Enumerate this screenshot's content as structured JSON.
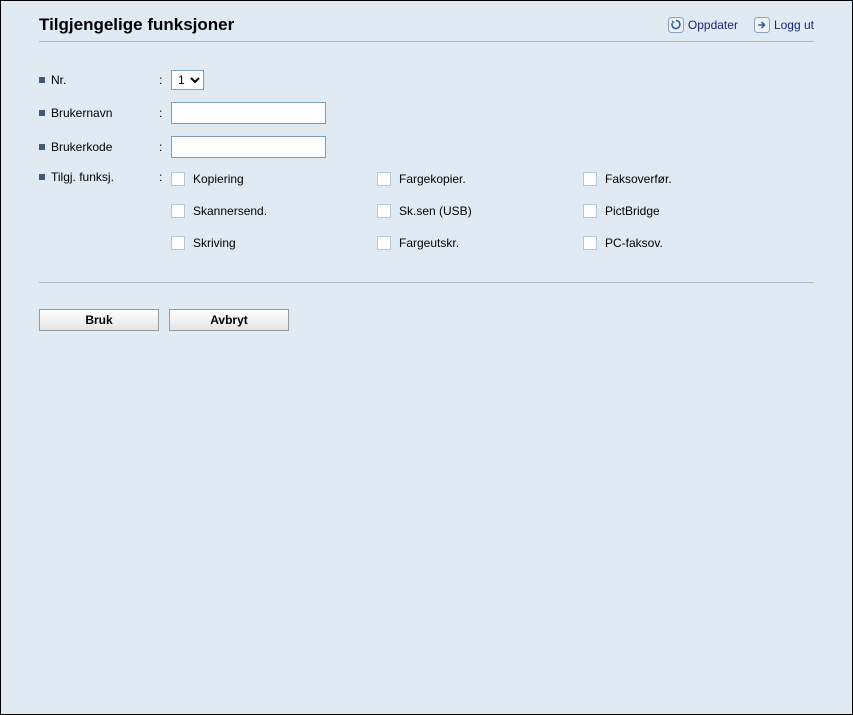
{
  "header": {
    "title": "Tilgjengelige funksjoner",
    "refresh_label": "Oppdater",
    "logout_label": "Logg ut"
  },
  "form": {
    "nr": {
      "label": "Nr.",
      "value": "1",
      "options": [
        "1"
      ]
    },
    "username": {
      "label": "Brukernavn",
      "value": ""
    },
    "usercode": {
      "label": "Brukerkode",
      "value": ""
    },
    "functions_label": "Tilgj. funksj.",
    "functions": [
      {
        "key": "copying",
        "label": "Kopiering",
        "checked": false
      },
      {
        "key": "colorcopy",
        "label": "Fargekopier.",
        "checked": false
      },
      {
        "key": "faxtransfer",
        "label": "Faksoverfør.",
        "checked": false
      },
      {
        "key": "scansend",
        "label": "Skannersend.",
        "checked": false
      },
      {
        "key": "scansendusb",
        "label": "Sk.sen (USB)",
        "checked": false
      },
      {
        "key": "pictbridge",
        "label": "PictBridge",
        "checked": false
      },
      {
        "key": "printing",
        "label": "Skriving",
        "checked": false
      },
      {
        "key": "colorprint",
        "label": "Fargeutskr.",
        "checked": false
      },
      {
        "key": "pcfax",
        "label": "PC-faksov.",
        "checked": false
      }
    ]
  },
  "buttons": {
    "apply": "Bruk",
    "cancel": "Avbryt"
  }
}
